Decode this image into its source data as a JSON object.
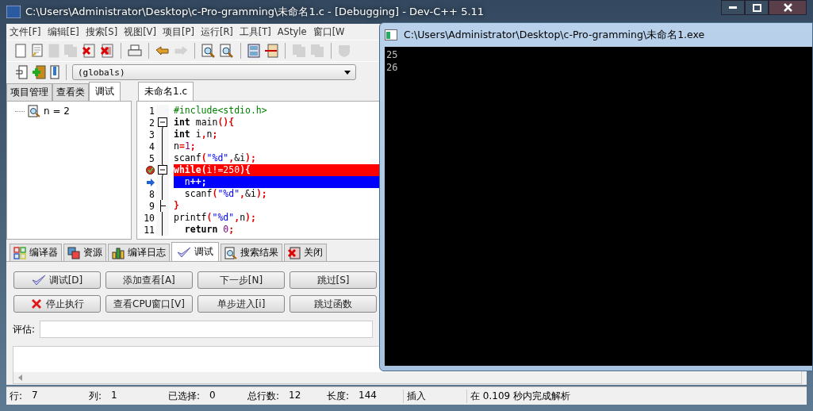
{
  "window": {
    "title": "C:\\Users\\Administrator\\Desktop\\c-Pro-gramming\\未命名1.c - [Debugging] - Dev-C++ 5.11"
  },
  "menu": [
    "文件[F]",
    "编辑[E]",
    "搜索[S]",
    "视图[V]",
    "项目[P]",
    "运行[R]",
    "工具[T]",
    "AStyle",
    "窗口[W"
  ],
  "toolbar": [
    {
      "kind": "doc",
      "disabled": false
    },
    {
      "kind": "doc-pen",
      "disabled": false
    },
    {
      "kind": "doc",
      "disabled": true
    },
    {
      "kind": "docs",
      "disabled": true
    },
    {
      "kind": "doc-x",
      "disabled": false
    },
    {
      "kind": "docs-x",
      "disabled": false
    },
    {
      "kind": "separator"
    },
    {
      "kind": "print",
      "disabled": false
    },
    {
      "kind": "separator"
    },
    {
      "kind": "undo",
      "disabled": false
    },
    {
      "kind": "redo",
      "disabled": true
    },
    {
      "kind": "separator"
    },
    {
      "kind": "find",
      "disabled": false
    },
    {
      "kind": "find",
      "disabled": false
    },
    {
      "kind": "separator"
    },
    {
      "kind": "panel",
      "disabled": false
    },
    {
      "kind": "indent",
      "disabled": false
    },
    {
      "kind": "separator"
    },
    {
      "kind": "docs",
      "disabled": true
    },
    {
      "kind": "docs",
      "disabled": true
    },
    {
      "kind": "separator"
    },
    {
      "kind": "shield",
      "disabled": true
    }
  ],
  "toolbar2": [
    {
      "kind": "project",
      "disabled": false
    },
    {
      "kind": "add",
      "disabled": false
    },
    {
      "kind": "bar",
      "disabled": false
    }
  ],
  "scope_dropdown": {
    "value": "(globals)"
  },
  "left_tabs": [
    {
      "label": "项目管理",
      "selected": false
    },
    {
      "label": "查看类",
      "selected": false
    },
    {
      "label": "调试",
      "selected": true
    }
  ],
  "watch_items": [
    {
      "label": "n = 2"
    }
  ],
  "editor_tabs": [
    {
      "label": "未命名1.c",
      "selected": true
    }
  ],
  "code_lines": [
    {
      "number": "1",
      "foldable": false,
      "block_end": false,
      "breakpoint": false,
      "current": false,
      "tokens": [
        {
          "kind": "pre",
          "text": "#include<stdio.h>"
        }
      ]
    },
    {
      "number": "2",
      "foldable": true,
      "block_end": false,
      "breakpoint": false,
      "current": false,
      "tokens": [
        {
          "kind": "kw",
          "text": "int"
        },
        {
          "kind": "plain",
          "text": " main"
        },
        {
          "kind": "sym",
          "text": "(){"
        }
      ]
    },
    {
      "number": "3",
      "foldable": false,
      "block_end": false,
      "breakpoint": false,
      "current": false,
      "tokens": [
        {
          "kind": "kw",
          "text": "int"
        },
        {
          "kind": "plain",
          "text": " i"
        },
        {
          "kind": "sym",
          "text": ","
        },
        {
          "kind": "plain",
          "text": "n"
        },
        {
          "kind": "sym",
          "text": ";"
        }
      ]
    },
    {
      "number": "4",
      "foldable": false,
      "block_end": false,
      "breakpoint": false,
      "current": false,
      "tokens": [
        {
          "kind": "plain",
          "text": "n"
        },
        {
          "kind": "sym",
          "text": "="
        },
        {
          "kind": "num",
          "text": "1"
        },
        {
          "kind": "sym",
          "text": ";"
        }
      ]
    },
    {
      "number": "5",
      "foldable": false,
      "block_end": false,
      "breakpoint": false,
      "current": false,
      "tokens": [
        {
          "kind": "plain",
          "text": "scanf"
        },
        {
          "kind": "sym",
          "text": "("
        },
        {
          "kind": "str",
          "text": "\"%d\""
        },
        {
          "kind": "sym",
          "text": ","
        },
        {
          "kind": "plain",
          "text": "&i"
        },
        {
          "kind": "sym",
          "text": ");"
        }
      ]
    },
    {
      "foldable": true,
      "block_end": false,
      "breakpoint": true,
      "current": false,
      "tokens": [
        {
          "kind": "kw",
          "text": "while"
        },
        {
          "kind": "sym",
          "text": "("
        },
        {
          "kind": "plain",
          "text": "i!="
        },
        {
          "kind": "num",
          "text": "250"
        },
        {
          "kind": "sym",
          "text": "){"
        }
      ]
    },
    {
      "foldable": false,
      "block_end": false,
      "breakpoint": false,
      "current": true,
      "tokens": [
        {
          "kind": "plain",
          "text": "  n"
        },
        {
          "kind": "sym",
          "text": "++;"
        }
      ]
    },
    {
      "number": "8",
      "foldable": false,
      "block_end": false,
      "breakpoint": false,
      "current": false,
      "tokens": [
        {
          "kind": "plain",
          "text": "  scanf"
        },
        {
          "kind": "sym",
          "text": "("
        },
        {
          "kind": "str",
          "text": "\"%d\""
        },
        {
          "kind": "sym",
          "text": ","
        },
        {
          "kind": "plain",
          "text": "&i"
        },
        {
          "kind": "sym",
          "text": ");"
        }
      ]
    },
    {
      "number": "9",
      "foldable": false,
      "block_end": true,
      "breakpoint": false,
      "current": false,
      "tokens": [
        {
          "kind": "sym",
          "text": "}"
        }
      ]
    },
    {
      "number": "10",
      "foldable": false,
      "block_end": false,
      "breakpoint": false,
      "current": false,
      "tokens": [
        {
          "kind": "plain",
          "text": "printf"
        },
        {
          "kind": "sym",
          "text": "("
        },
        {
          "kind": "str",
          "text": "\"%d\""
        },
        {
          "kind": "sym",
          "text": ","
        },
        {
          "kind": "plain",
          "text": "n"
        },
        {
          "kind": "sym",
          "text": ");"
        }
      ]
    },
    {
      "number": "11",
      "foldable": false,
      "block_end": false,
      "breakpoint": false,
      "current": false,
      "tokens": [
        {
          "kind": "kw",
          "text": "  return"
        },
        {
          "kind": "num",
          "text": " 0"
        },
        {
          "kind": "sym",
          "text": ";"
        }
      ]
    }
  ],
  "bottom_tabs": [
    {
      "label": "编译器",
      "kind": "grid",
      "selected": false
    },
    {
      "label": "资源",
      "kind": "layers",
      "selected": false
    },
    {
      "label": "编译日志",
      "kind": "chart",
      "selected": false
    },
    {
      "label": "调试",
      "kind": "check",
      "selected": true
    },
    {
      "label": "搜索结果",
      "kind": "find",
      "selected": false
    },
    {
      "label": "关闭",
      "kind": "close",
      "selected": false
    }
  ],
  "debug_buttons": [
    {
      "label": "调试[D]",
      "kind": "check"
    },
    {
      "label": "添加查看[A]",
      "kind": "none"
    },
    {
      "label": "下一步[N]",
      "kind": "none"
    },
    {
      "label": "跳过[S]",
      "kind": "none"
    },
    {
      "label": "停止执行",
      "kind": "stop"
    },
    {
      "label": "查看CPU窗口[V]",
      "kind": "none"
    },
    {
      "label": "单步进入[i]",
      "kind": "none"
    },
    {
      "label": "跳过函数",
      "kind": "none"
    }
  ],
  "evaluate": {
    "label": "评估:"
  },
  "status_bar": [
    {
      "label": "行:",
      "value": "7"
    },
    {
      "label": "列:",
      "value": "1"
    },
    {
      "label": "已选择:",
      "value": "0"
    },
    {
      "label": "总行数:",
      "value": "12"
    },
    {
      "label": "长度:",
      "value": "144"
    },
    {
      "label": "插入"
    },
    {
      "label": "在 0.109 秒内完成解析"
    }
  ],
  "console": {
    "title": "C:\\Users\\Administrator\\Desktop\\c-Pro-gramming\\未命名1.exe",
    "lines": [
      "25",
      "26"
    ]
  }
}
